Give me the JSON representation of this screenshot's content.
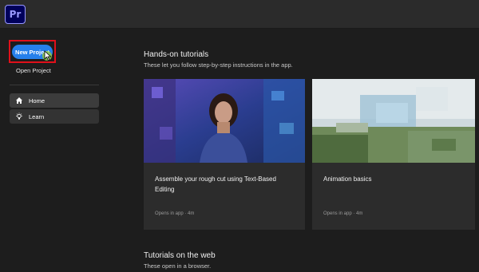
{
  "app": {
    "logo_text": "Pr",
    "accent": "#2680eb",
    "logo_bg": "#00005b",
    "logo_fg": "#9999ff"
  },
  "sidebar": {
    "new_project_label": "New Project",
    "open_project_label": "Open Project",
    "nav": [
      {
        "label": "Home",
        "icon": "home-icon",
        "active": true
      },
      {
        "label": "Learn",
        "icon": "lightbulb-icon",
        "active": false
      }
    ]
  },
  "main": {
    "hands_on": {
      "title": "Hands-on tutorials",
      "subtitle": "These let you follow step-by-step instructions in the app."
    },
    "cards": [
      {
        "title": "Assemble your rough cut using Text-Based Editing",
        "meta": "Opens in app · 4m",
        "thumbnail": "presenter-on-blue-stage-thumbnail"
      },
      {
        "title": "Animation basics",
        "meta": "Opens in app · 4m",
        "thumbnail": "landscape-with-sky-thumbnail"
      }
    ],
    "web": {
      "title": "Tutorials on the web",
      "subtitle": "These open in a browser."
    }
  }
}
